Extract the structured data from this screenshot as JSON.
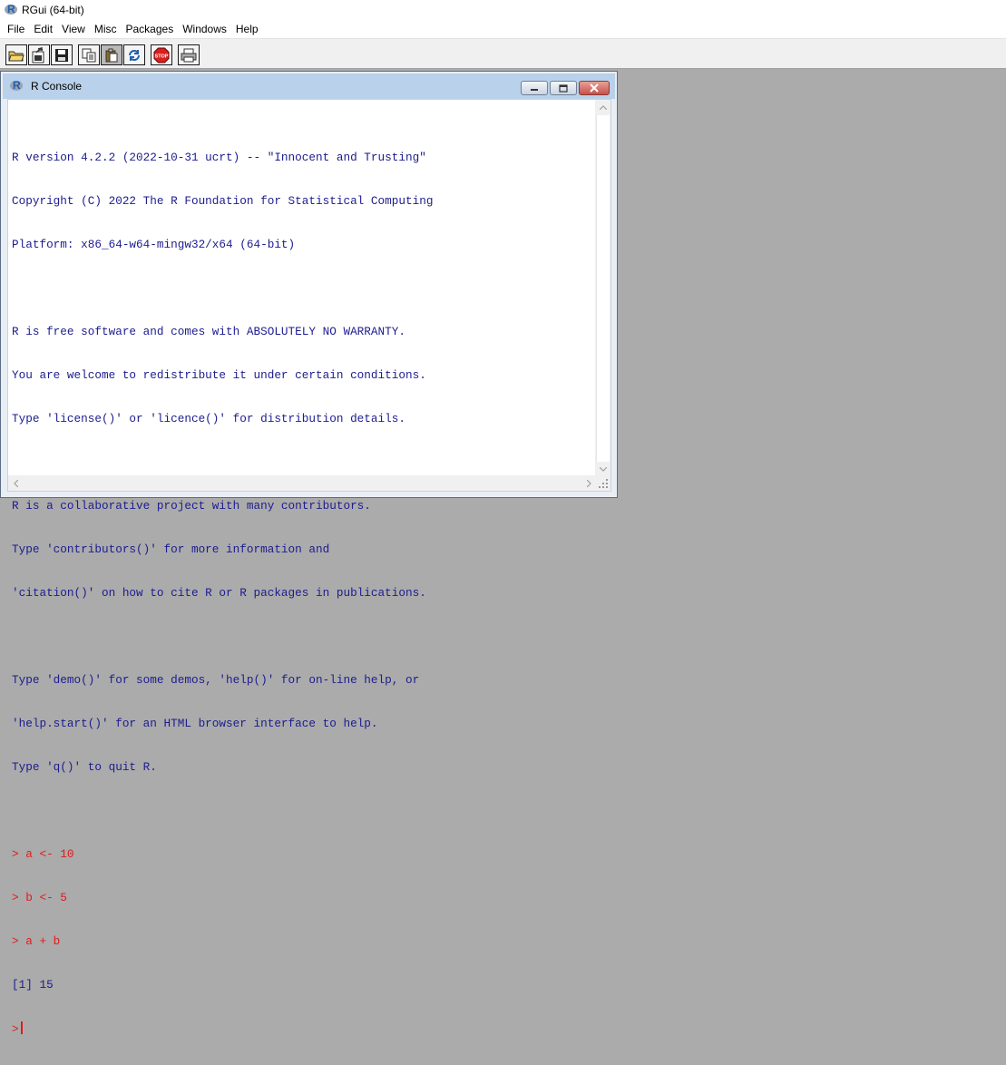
{
  "app": {
    "title": "RGui (64-bit)",
    "icon": "r-logo-icon"
  },
  "menu": [
    "File",
    "Edit",
    "View",
    "Misc",
    "Packages",
    "Windows",
    "Help"
  ],
  "toolbar": {
    "buttons": [
      "open-script-icon",
      "load-workspace-icon",
      "save-workspace-icon",
      "copy-icon",
      "paste-icon",
      "copy-paste-icon",
      "stop-icon",
      "print-icon"
    ],
    "stop_label": "STOP"
  },
  "console_window": {
    "title": "R Console",
    "output_lines": [
      "R version 4.2.2 (2022-10-31 ucrt) -- \"Innocent and Trusting\"",
      "Copyright (C) 2022 The R Foundation for Statistical Computing",
      "Platform: x86_64-w64-mingw32/x64 (64-bit)",
      "",
      "R is free software and comes with ABSOLUTELY NO WARRANTY.",
      "You are welcome to redistribute it under certain conditions.",
      "Type 'license()' or 'licence()' for distribution details.",
      "",
      "R is a collaborative project with many contributors.",
      "Type 'contributors()' for more information and",
      "'citation()' on how to cite R or R packages in publications.",
      "",
      "Type 'demo()' for some demos, 'help()' for on-line help, or",
      "'help.start()' for an HTML browser interface to help.",
      "Type 'q()' to quit R.",
      ""
    ],
    "commands": [
      "> a <- 10",
      "> b <- 5",
      "> a + b"
    ],
    "result": "[1] 15",
    "prompt": ">"
  },
  "colors": {
    "output_text": "#1c1c8f",
    "command_text": "#e41919",
    "mdi_background": "#ababab",
    "window_frame": "#b9d1ea"
  }
}
